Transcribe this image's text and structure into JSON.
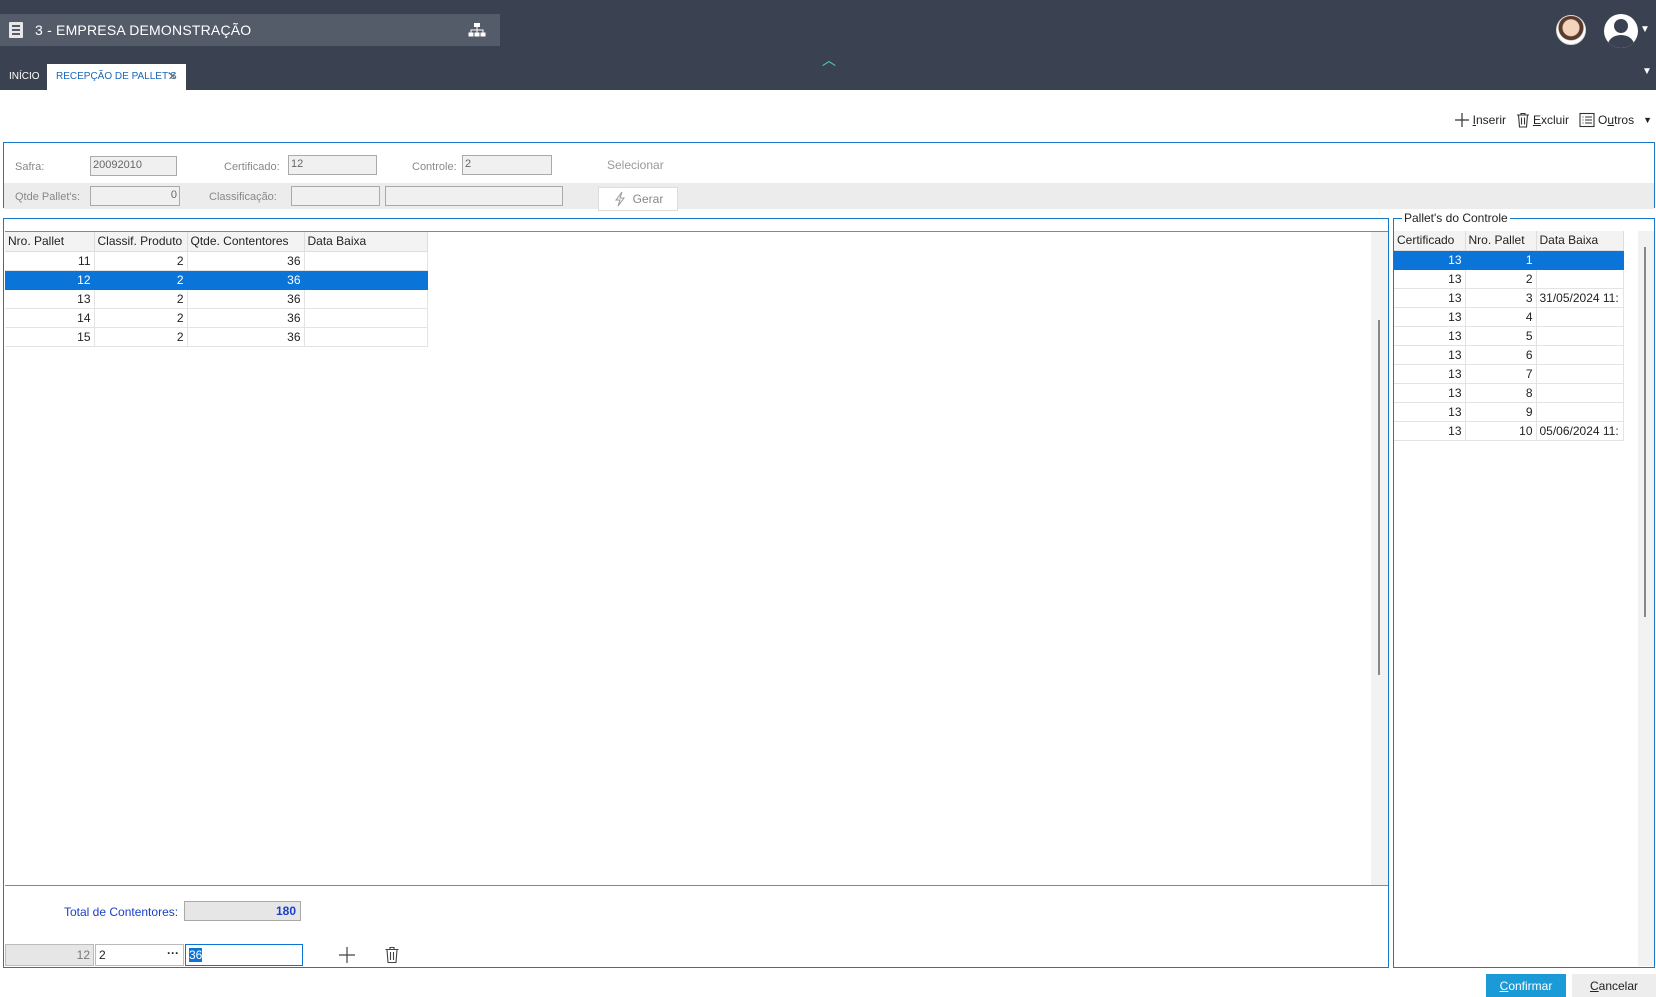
{
  "header": {
    "company": "3 - EMPRESA DEMONSTRAÇÃO",
    "tabs": [
      {
        "label": "INÍCIO"
      },
      {
        "label": "RECEPÇÃO DE PALLET'S"
      }
    ],
    "tab_close": "✕"
  },
  "toolbar": {
    "insert_first": "I",
    "insert_rest": "nserir",
    "delete_first": "E",
    "delete_rest": "xcluir",
    "others_first": "O",
    "others_mid": "u",
    "others_rest": "tros"
  },
  "filter": {
    "safra_label": "Safra:",
    "safra_value": "20092010",
    "certificado_label": "Certificado:",
    "certificado_value": "12",
    "controle_label": "Controle:",
    "controle_value": "2",
    "selecionar_label": "Selecionar",
    "qtde_label": "Qtde Pallet's:",
    "qtde_value": "0",
    "classificacao_label": "Classificação:",
    "classificacao_value1": "",
    "classificacao_value2": "",
    "gerar_label": "Gerar"
  },
  "main_grid": {
    "columns": [
      "Nro. Pallet",
      "Classif. Produto",
      "Qtde. Contentores",
      "Data Baixa"
    ],
    "rows": [
      {
        "nro": "11",
        "classif": "2",
        "qtde": "36",
        "data": ""
      },
      {
        "nro": "12",
        "classif": "2",
        "qtde": "36",
        "data": ""
      },
      {
        "nro": "13",
        "classif": "2",
        "qtde": "36",
        "data": ""
      },
      {
        "nro": "14",
        "classif": "2",
        "qtde": "36",
        "data": ""
      },
      {
        "nro": "15",
        "classif": "2",
        "qtde": "36",
        "data": ""
      }
    ],
    "selected_row": 1,
    "total_label": "Total de Contentores:",
    "total_value": "180"
  },
  "edit_row": {
    "nro": "12",
    "classif": "2",
    "qtde": "36",
    "dots": "···"
  },
  "right_panel": {
    "title": "Pallet's do Controle",
    "columns": [
      "Certificado",
      "Nro. Pallet",
      "Data Baixa"
    ],
    "rows": [
      {
        "cert": "13",
        "nro": "1",
        "data": ""
      },
      {
        "cert": "13",
        "nro": "2",
        "data": ""
      },
      {
        "cert": "13",
        "nro": "3",
        "data": "31/05/2024 11:"
      },
      {
        "cert": "13",
        "nro": "4",
        "data": ""
      },
      {
        "cert": "13",
        "nro": "5",
        "data": ""
      },
      {
        "cert": "13",
        "nro": "6",
        "data": ""
      },
      {
        "cert": "13",
        "nro": "7",
        "data": ""
      },
      {
        "cert": "13",
        "nro": "8",
        "data": ""
      },
      {
        "cert": "13",
        "nro": "9",
        "data": ""
      },
      {
        "cert": "13",
        "nro": "10",
        "data": "05/06/2024 11:"
      }
    ],
    "selected_row": 0
  },
  "footer": {
    "confirm_first": "C",
    "confirm_rest": "onfirmar",
    "cancel_first": "C",
    "cancel_rest": "ancelar"
  },
  "colors": {
    "topbar": "#3a4150",
    "selection": "#0a74d8",
    "accent_border": "#1a78c8",
    "confirm": "#1a9ad6"
  }
}
